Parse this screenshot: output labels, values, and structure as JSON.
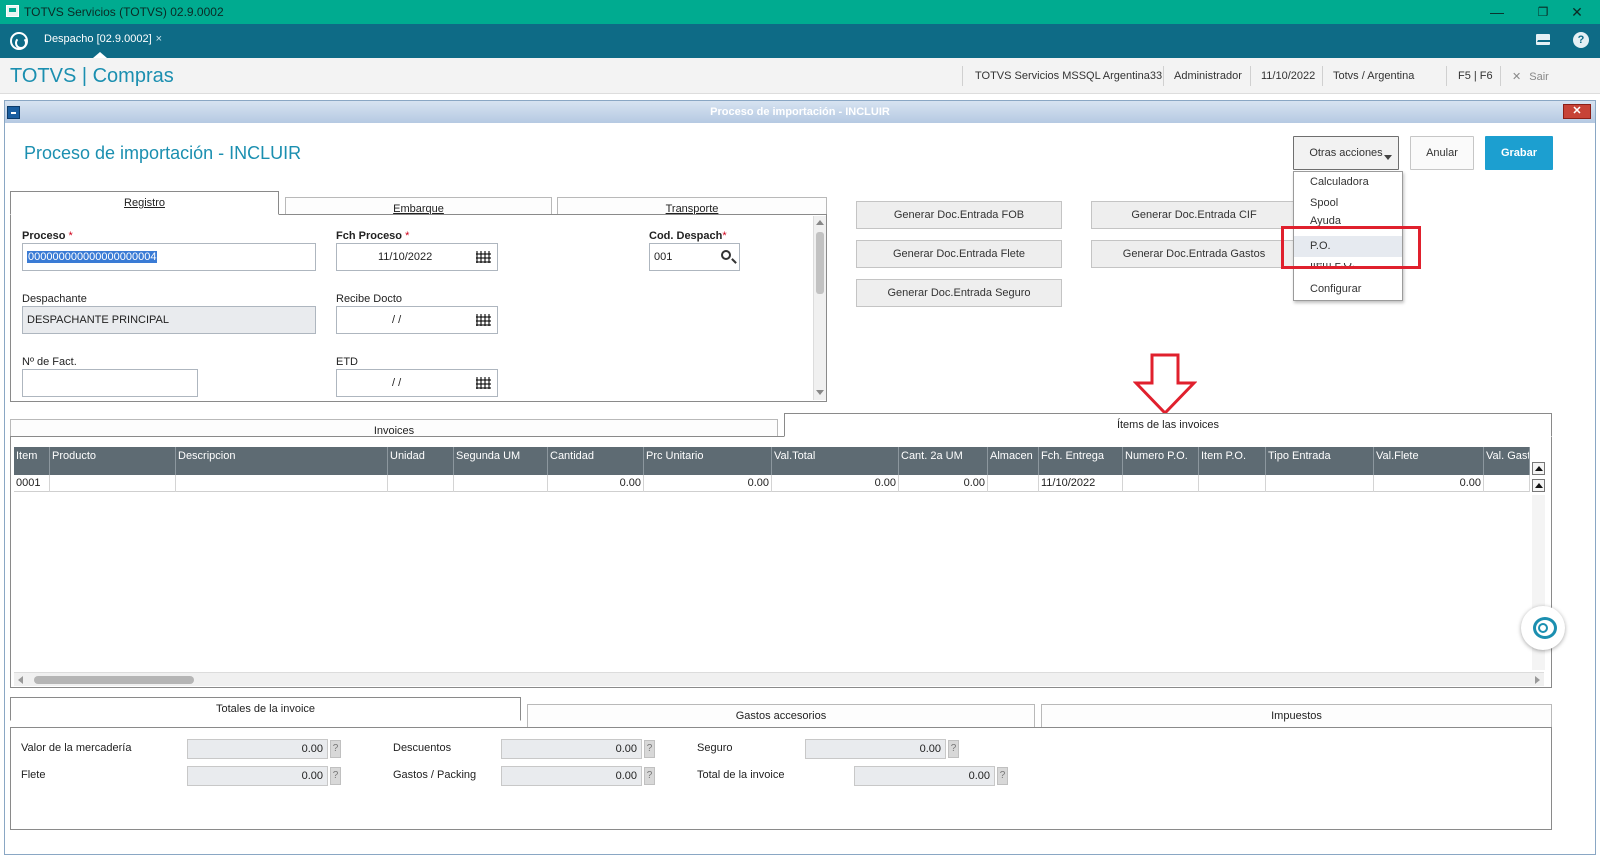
{
  "window": {
    "title": "TOTVS Servicios (TOTVS) 02.9.0002",
    "minimize": "—",
    "maximize": "❐",
    "close": "✕"
  },
  "app_tab": {
    "label": "Despacho [02.9.0002]",
    "close": "×"
  },
  "module_header": {
    "brand": "TOTVS | Compras",
    "server": "TOTVS Servicios MSSQL Argentina33",
    "user": "Administrador",
    "date": "11/10/2022",
    "company": "Totvs / Argentina",
    "keys": "F5 | F6",
    "exit": "Sair",
    "exit_icon": "✕"
  },
  "dialog": {
    "bar_title": "Proceso de importación - INCLUIR",
    "close": "✕",
    "page_title": "Proceso de importación - INCLUIR",
    "actions": {
      "other": "Otras acciones",
      "cancel": "Anular",
      "save": "Grabar"
    },
    "menu": [
      {
        "label": "Calculadora"
      },
      {
        "label": "Spool"
      },
      {
        "label": "Ayuda"
      },
      {
        "label": "P.O."
      },
      {
        "label": "Ítem P.O."
      },
      {
        "label": "Configurar"
      }
    ],
    "top_tabs": [
      "Registro",
      "Embarque",
      "Transporte"
    ],
    "form": {
      "proceso_label": "Proceso",
      "proceso_value": "000000000000000000004",
      "fch_proceso_label": "Fch Proceso",
      "fch_proceso_value": "11/10/2022",
      "cod_despach_label": "Cod. Despach",
      "cod_despach_value": "001",
      "despachante_label": "Despachante",
      "despachante_value": "DESPACHANTE PRINCIPAL",
      "recibe_docto_label": "Recibe Docto",
      "recibe_docto_value": " / /",
      "nro_fact_label": "Nº de Fact.",
      "nro_fact_value": "",
      "etd_label": "ETD",
      "etd_value": " / /",
      "required_mark": "*"
    },
    "generate_buttons": [
      "Generar Doc.Entrada FOB",
      "Generar Doc.Entrada CIF",
      "Generar Doc.Entrada Flete",
      "Generar Doc.Entrada Gastos",
      "Generar Doc.Entrada Seguro"
    ],
    "mid_tabs": [
      "Invoices",
      "Ítems de las invoices"
    ],
    "grid": {
      "columns": [
        "Item",
        "Producto",
        "Descripcion",
        "Unidad",
        "Segunda UM",
        "Cantidad",
        "Prc Unitario",
        "Val.Total",
        "Cant. 2a UM",
        "Almacen",
        "Fch. Entrega",
        "Numero P.O.",
        "Item P.O.",
        "Tipo Entrada",
        "Val.Flete",
        "Val. Gast"
      ],
      "rows": [
        [
          "0001",
          "",
          "",
          "",
          "",
          "0.00",
          "0.00",
          "0.00",
          "0.00",
          "",
          "11/10/2022",
          "",
          "",
          "",
          "0.00",
          ""
        ]
      ]
    },
    "bottom_tabs": [
      "Totales de la invoice",
      "Gastos accesorios",
      "Impuestos"
    ],
    "totals": {
      "valor_mercaderia_label": "Valor de la mercadería",
      "valor_mercaderia_value": "0.00",
      "flete_label": "Flete",
      "flete_value": "0.00",
      "descuentos_label": "Descuentos",
      "descuentos_value": "0.00",
      "gastos_packing_label": "Gastos / Packing",
      "gastos_packing_value": "0.00",
      "seguro_label": "Seguro",
      "seguro_value": "0.00",
      "total_invoice_label": "Total de la invoice",
      "total_invoice_value": "0.00",
      "help_glyph": "?"
    }
  },
  "colors": {
    "titlebar": "#00ab90",
    "tabbar": "#0e6b86",
    "brand": "#1b8fb0",
    "primary_button": "#1c9fd0",
    "grid_header": "#5e6b73",
    "highlight_red": "#e0202d"
  }
}
